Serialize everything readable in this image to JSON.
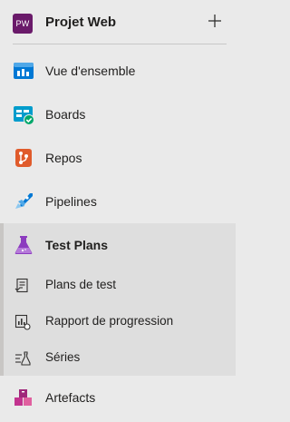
{
  "project": {
    "avatar_text": "PW",
    "name": "Projet Web",
    "add_symbol": "+",
    "avatar_color": "#6a1a6a"
  },
  "nav": {
    "items": [
      {
        "label": "Vue d'ensemble",
        "icon": "overview-icon"
      },
      {
        "label": "Boards",
        "icon": "boards-icon"
      },
      {
        "label": "Repos",
        "icon": "repos-icon"
      },
      {
        "label": "Pipelines",
        "icon": "pipelines-icon"
      },
      {
        "label": "Test Plans",
        "icon": "test-plans-icon",
        "expanded": true
      },
      {
        "label": "Artefacts",
        "icon": "artifacts-icon"
      }
    ],
    "test_plans_children": [
      {
        "label": "Plans de test",
        "icon": "test-plan-list-icon"
      },
      {
        "label": "Rapport de progression",
        "icon": "progress-report-icon"
      },
      {
        "label": "Séries",
        "icon": "runs-icon"
      }
    ]
  },
  "colors": {
    "background": "#eaeaea",
    "selected_group": "#dedede",
    "overview": "#0078d4",
    "boards": "#009ccc",
    "repos": "#e05b2b",
    "pipelines": "#0078d4",
    "test_plans": "#8c3cbf",
    "artifacts": "#c2338f"
  }
}
